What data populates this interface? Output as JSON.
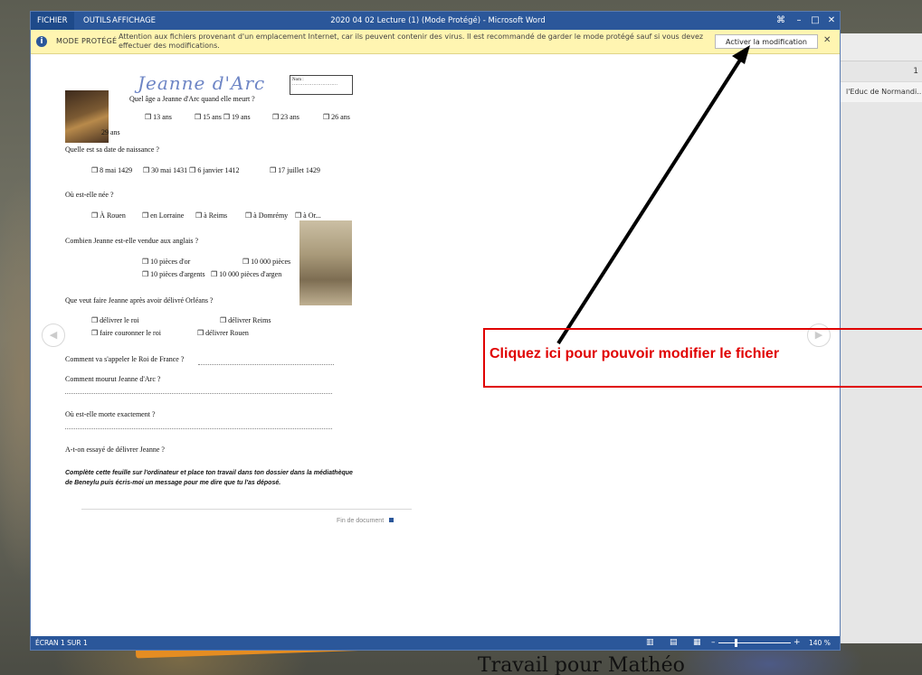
{
  "window": {
    "title": "2020 04 02 Lecture (1) (Mode Protégé) - Microsoft Word",
    "menus": [
      "FICHIER",
      "OUTILS",
      "AFFICHAGE"
    ],
    "controls": [
      "⌘",
      "–",
      "□",
      "✕"
    ]
  },
  "protected_bar": {
    "label": "MODE PROTÉGÉ",
    "message": "Attention aux fichiers provenant d'un emplacement Internet, car ils peuvent contenir des virus. Il est recommandé de garder le mode protégé sauf si vous devez effectuer des modifications.",
    "enable_button": "Activer la modification",
    "close": "✕"
  },
  "side_panel": {
    "row1": "1",
    "row2": "l'Educ de Normandi..."
  },
  "document": {
    "title": "Jeanne d'Arc",
    "name_label": "Nom :",
    "name_line": "…………………………",
    "q1": "Quel âge a Jeanne d'Arc quand elle meurt ?",
    "q1_opts": [
      "❒ 13 ans",
      "❒ 15 ans ❒ 19 ans",
      "❒ 23 ans",
      "❒ 26 ans"
    ],
    "q1_extra": "29 ans",
    "q2": "Quelle est sa date de naissance ?",
    "q2_opts": [
      "❒ 8 mai 1429",
      "❒ 30 mai 1431 ❒ 6 janvier 1412",
      "❒ 17 juillet 1429"
    ],
    "q3": "Où est-elle née ?",
    "q3_opts": [
      "❒  À Rouen",
      "❒ en Lorraine",
      "❒ à Reims",
      "❒ à Domrémy",
      "❒ à Or..."
    ],
    "q4": "Combien Jeanne est-elle vendue aux anglais ?",
    "q4_opts": [
      "❒  10 pièces d'or",
      "❒ 10 000 pièces",
      "❒ 10 pièces d'argents",
      "❒ 10 000 pièces d'argen"
    ],
    "q5": "Que veut faire Jeanne après avoir délivré Orléans ?",
    "q5_opts": [
      "❒  délivrer le roi",
      "❒ délivrer Reims",
      "❒      faire couronner le roi",
      "❒ délivrer Rouen"
    ],
    "q6": "Comment va s'appeler le Roi de France ?",
    "q7": "Comment mourut Jeanne d'Arc ?",
    "q8": "Où est-elle morte exactement ?",
    "q9": "A-t-on essayé de délivrer Jeanne ?",
    "instructions": "Complète cette feuille sur l'ordinateur et place ton travail dans ton dossier dans la médiathèque de Beneylu puis écris-moi un message pour me dire que tu l'as déposé.",
    "end": "Fin de document"
  },
  "statusbar": {
    "page": "ÉCRAN 1 SUR 1",
    "zoom_minus": "–",
    "zoom_plus": "+",
    "zoom": "140 %"
  },
  "annotation": {
    "text": "Cliquez ici pour pouvoir modifier le fichier",
    "color": "#e00000"
  },
  "background": {
    "caption": "Travail pour Mathéo"
  }
}
